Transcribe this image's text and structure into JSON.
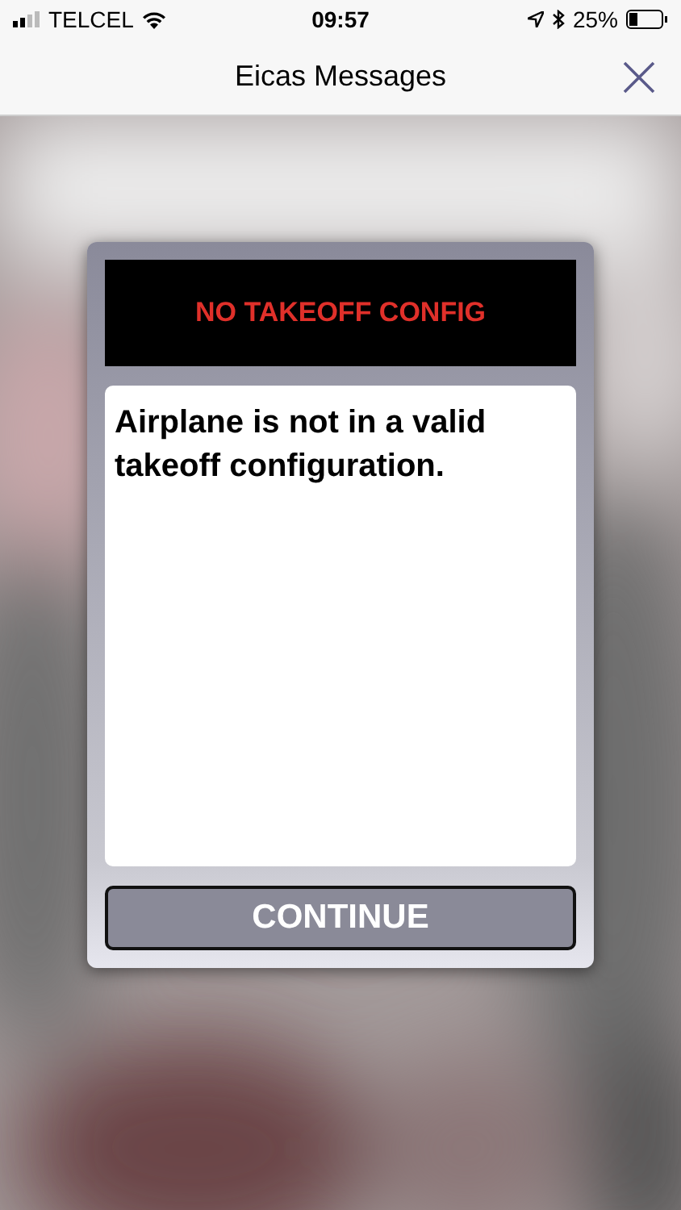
{
  "status_bar": {
    "carrier": "TELCEL",
    "time": "09:57",
    "battery": "25%"
  },
  "nav_bar": {
    "title": "Eicas Messages"
  },
  "dialog": {
    "alert": "NO TAKEOFF CONFIG",
    "message": "Airplane is not in a valid takeoff configuration.",
    "button": "CONTINUE"
  }
}
